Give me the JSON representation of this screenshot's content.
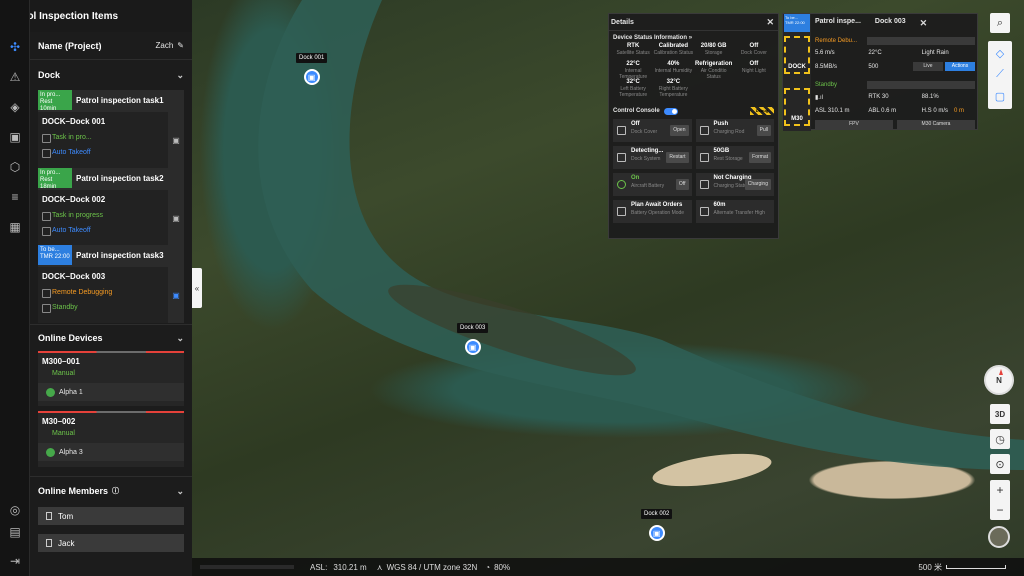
{
  "header": {
    "title": "Patrol Inspection Items"
  },
  "project": {
    "label": "Name (Project)",
    "user": "Zach"
  },
  "dock_section": {
    "title": "Dock",
    "tasks": [
      {
        "badge": "In pro...",
        "badge_sub": "Rest 10min",
        "name": "Patrol inspection task1",
        "device": "DOCK–Dock 001",
        "status": "Task in pro...",
        "mode": "Auto Takeoff"
      },
      {
        "badge": "In pro...",
        "badge_sub": "Rest 18min",
        "name": "Patrol inspection task2",
        "device": "DOCK–Dock 002",
        "status": "Task in progress",
        "mode": "Auto Takeoff"
      },
      {
        "badge": "To be...",
        "badge_sub": "TMR 22:00",
        "name": "Patrol inspection task3",
        "device": "DOCK–Dock 003",
        "status": "Remote Debugging",
        "mode": "Standby"
      }
    ]
  },
  "devices_section": {
    "title": "Online Devices",
    "devices": [
      {
        "name": "M300–001",
        "mode": "Manual",
        "pilot": "Alpha 1"
      },
      {
        "name": "M30–002",
        "mode": "Manual",
        "pilot": "Alpha 3"
      }
    ]
  },
  "members_section": {
    "title": "Online Members",
    "members": [
      "Tom",
      "Jack"
    ]
  },
  "map": {
    "docks": [
      "Dock 001",
      "Dock 003",
      "Dock 002"
    ]
  },
  "details": {
    "title": "Details",
    "status_title": "Device Status Information",
    "status": [
      {
        "value": "RTK",
        "key": "Satellite Status"
      },
      {
        "value": "Calibrated",
        "key": "Calibration Status"
      },
      {
        "value": "20/80 GB",
        "key": "Storage"
      },
      {
        "value": "Off",
        "key": "Dock Cover"
      },
      {
        "value": "22°C",
        "key": "Internal Temperature"
      },
      {
        "value": "40%",
        "key": "Internal Humidity"
      },
      {
        "value": "Refrigeration",
        "key": "Air Conditio Status"
      },
      {
        "value": "Off",
        "key": "Night Light"
      },
      {
        "value": "32°C",
        "key": "Left Battery Temperature"
      },
      {
        "value": "32°C",
        "key": "Right Battery Temperature"
      }
    ],
    "console_title": "Control Console",
    "console_badge": "Debug",
    "console": [
      {
        "value": "Off",
        "key": "Dock Cover",
        "btn": "Open"
      },
      {
        "value": "Push",
        "key": "Charging Rod",
        "btn": "Pull"
      },
      {
        "value": "Detecting...",
        "key": "Dock System",
        "btn": "Restart"
      },
      {
        "value": "50GB",
        "key": "Rest Storage",
        "btn": "Format"
      },
      {
        "value": "On",
        "key": "Aircraft Battery",
        "btn": "Off"
      },
      {
        "value": "Not Charging",
        "key": "Charging Status",
        "btn": "Charging"
      },
      {
        "value": "Plan  Await Orders",
        "key": "Battery Operation Mode",
        "btn": ""
      },
      {
        "value": "60m",
        "key": "Alternate Transfer High",
        "btn": ""
      }
    ]
  },
  "patrol_panel": {
    "tag": "To be...",
    "tag_sub": "TMR 22:00",
    "title": "Patrol inspe...",
    "dock": "Dock 003",
    "dock_label": "DOCK",
    "drone_label": "M30",
    "remote": "Remote Debu...",
    "wind": "5.6 m/s",
    "temp": "22°C",
    "weather": "Light Rain",
    "net": "8.5MB/s",
    "battery_dock": "500",
    "live": "Live",
    "actions": "Actions",
    "standby": "Standby",
    "rtk": "RTK",
    "rtk_count": "30",
    "battery": "88.1%",
    "asl": "ASL 310.1 m",
    "abl": "ABL 0.6 m",
    "hs": "H.S 0 m/s",
    "counter": "0 m",
    "fpv": "FPV",
    "camera": "M30 Camera"
  },
  "status_bar": {
    "asl_label": "ASL:",
    "asl_value": "310.21 m",
    "coord": "WGS 84 / UTM zone 32N",
    "progress": "80%",
    "scale": "500 米"
  },
  "tools": {
    "view3d": "3D",
    "compass": "N"
  }
}
